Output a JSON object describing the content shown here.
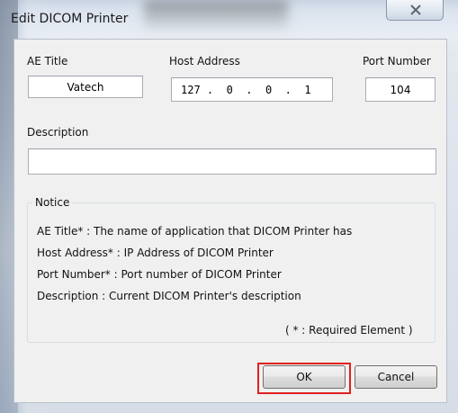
{
  "window": {
    "title": "Edit DICOM Printer",
    "close_icon": "close-icon"
  },
  "fields": {
    "ae_title": {
      "label": "AE Title",
      "value": "Vatech"
    },
    "host_address": {
      "label": "Host Address",
      "octets": [
        "127",
        "0",
        "0",
        "1"
      ]
    },
    "port_number": {
      "label": "Port Number",
      "value": "104"
    },
    "description": {
      "label": "Description",
      "value": ""
    }
  },
  "notice": {
    "title": "Notice",
    "lines": [
      "AE Title* : The name of application that DICOM Printer has",
      "Host Address* : IP Address of DICOM Printer",
      "Port Number* : Port number of DICOM Printer",
      "Description : Current DICOM Printer's description"
    ],
    "required_note": "( * : Required Element )"
  },
  "buttons": {
    "ok": "OK",
    "cancel": "Cancel"
  },
  "colors": {
    "highlight": "#e02020"
  }
}
